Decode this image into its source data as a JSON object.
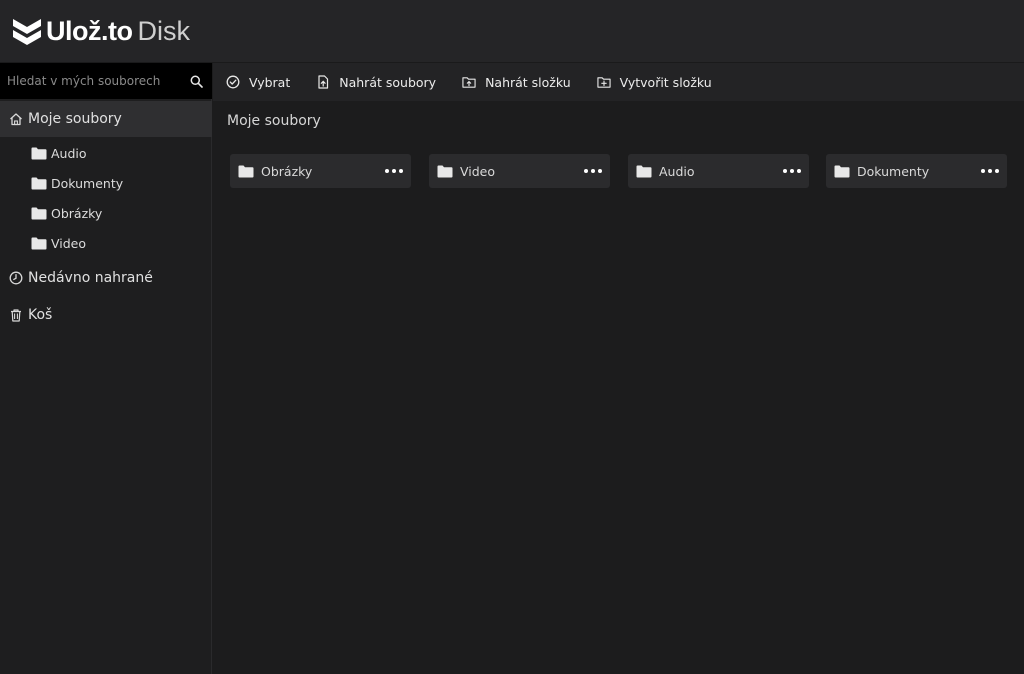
{
  "header": {
    "brand": "Ulož.to",
    "product": "Disk"
  },
  "search": {
    "placeholder": "Hledat v mých souborech"
  },
  "sidebar": {
    "my_files": "Moje soubory",
    "folders": [
      "Audio",
      "Dokumenty",
      "Obrázky",
      "Video"
    ],
    "recent": "Nedávno nahrané",
    "trash": "Koš"
  },
  "toolbar": {
    "select": "Vybrat",
    "upload_files": "Nahrát soubory",
    "upload_folder": "Nahrát složku",
    "create_folder": "Vytvořit složku"
  },
  "main": {
    "title": "Moje soubory",
    "folders": [
      "Obrázky",
      "Video",
      "Audio",
      "Dokumenty"
    ]
  },
  "colors": {
    "background": "#1c1c1d",
    "header": "#252527",
    "card": "#2b2b2d",
    "accent": "#ffffff"
  }
}
